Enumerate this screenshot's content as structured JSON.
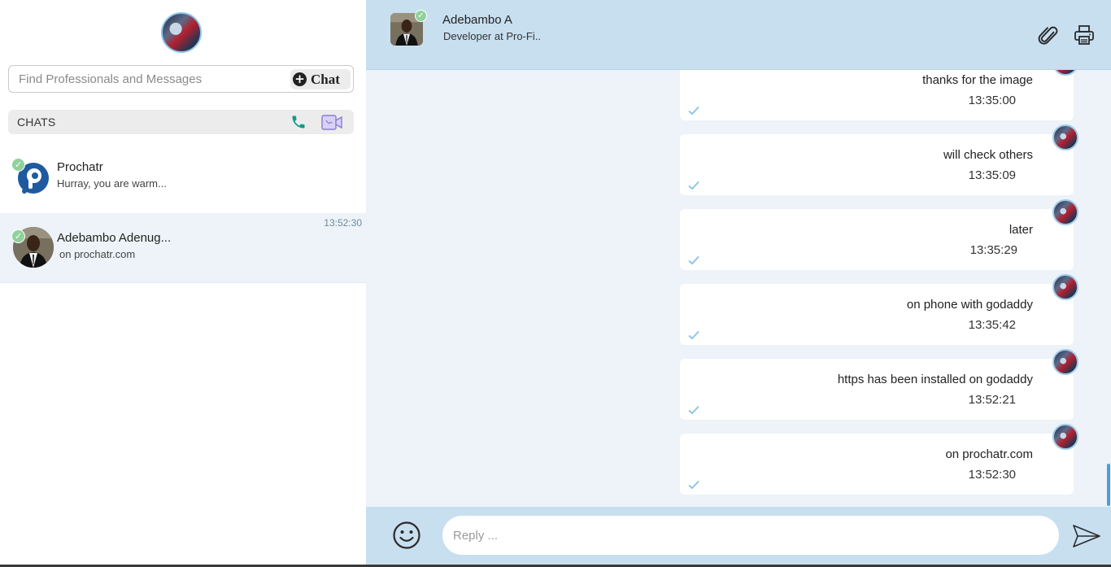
{
  "sidebar": {
    "search": {
      "placeholder": "Find Professionals and Messages"
    },
    "new_chat_label": "Chat",
    "chats_heading": "CHATS",
    "chats": [
      {
        "name": "Prochatr",
        "preview": "Hurray, you are warm...",
        "time": "",
        "online": true
      },
      {
        "name": "Adebambo Adenug...",
        "preview": "on prochatr.com",
        "time": "13:52:30",
        "online": true,
        "active": true
      }
    ]
  },
  "conversation": {
    "header": {
      "name": "Adebambo A",
      "subtitle": "Developer at Pro-Fi.."
    },
    "messages": [
      {
        "text": "thanks for the image",
        "time": "13:35:00",
        "read": true
      },
      {
        "text": "will check others",
        "time": "13:35:09",
        "read": true
      },
      {
        "text": "later",
        "time": "13:35:29",
        "read": true
      },
      {
        "text": "on phone with godaddy",
        "time": "13:35:42",
        "read": true
      },
      {
        "text": "https has been installed on godaddy",
        "time": "13:52:21",
        "read": true
      },
      {
        "text": "on prochatr.com",
        "time": "13:52:30",
        "read": true
      }
    ],
    "reply": {
      "placeholder": "Reply ..."
    }
  },
  "colors": {
    "header_bg": "#c8dff0",
    "chat_bg": "#edf3f8",
    "accent": "#4a9fd8",
    "online": "#8fd19a",
    "call_icon": "#129a8a",
    "video_icon": "#8a7bd8"
  },
  "icons": [
    "search-input",
    "plus-circle-icon",
    "phone-icon",
    "video-camera-icon",
    "paperclip-icon",
    "printer-icon",
    "check-icon",
    "smiley-icon",
    "send-icon"
  ]
}
